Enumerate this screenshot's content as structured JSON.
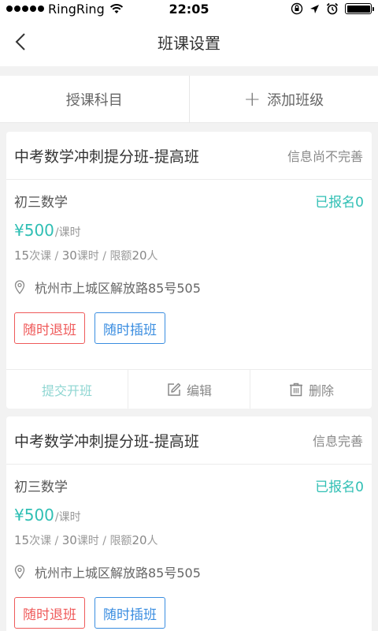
{
  "status_bar": {
    "carrier": "RingRing",
    "time": "22:05",
    "icons": [
      "signal-dots-icon",
      "wifi-icon",
      "orientation-lock-icon",
      "location-icon",
      "alarm-icon",
      "battery-icon"
    ]
  },
  "nav": {
    "title": "班课设置",
    "back_icon": "chevron-left-icon"
  },
  "tabs": [
    {
      "label": "授课科目"
    },
    {
      "label": "添加班级",
      "icon": "plus-icon"
    }
  ],
  "cards": [
    {
      "class_name": "中考数学冲刺提分班-提高班",
      "info_status": "信息尚不完善",
      "subject": "初三数学",
      "enrolled": "已报名0",
      "price": "¥500",
      "price_unit": "/课时",
      "lessons": "15",
      "lessons_unit": "次课",
      "separator": " / ",
      "hours": "30",
      "hours_unit": "课时",
      "limit_label": "限额",
      "limit": "20",
      "limit_unit": "人",
      "address": "杭州市上城区解放路85号505",
      "tag_refund": "随时退班",
      "tag_join": "随时插班",
      "action_submit": "提交开班",
      "action_edit": "编辑",
      "action_delete": "删除"
    },
    {
      "class_name": "中考数学冲刺提分班-提高班",
      "info_status": "信息完善",
      "subject": "初三数学",
      "enrolled": "已报名0",
      "price": "¥500",
      "price_unit": "/课时",
      "lessons": "15",
      "lessons_unit": "次课",
      "separator": " / ",
      "hours": "30",
      "hours_unit": "课时",
      "limit_label": "限额",
      "limit": "20",
      "limit_unit": "人",
      "address": "杭州市上城区解放路85号505",
      "tag_refund": "随时退班",
      "tag_join": "随时插班"
    }
  ],
  "colors": {
    "accent_teal": "#2fbfb4",
    "tag_red": "#ef5a5a",
    "tag_blue": "#3a8de0",
    "background": "#f2f2f2"
  }
}
